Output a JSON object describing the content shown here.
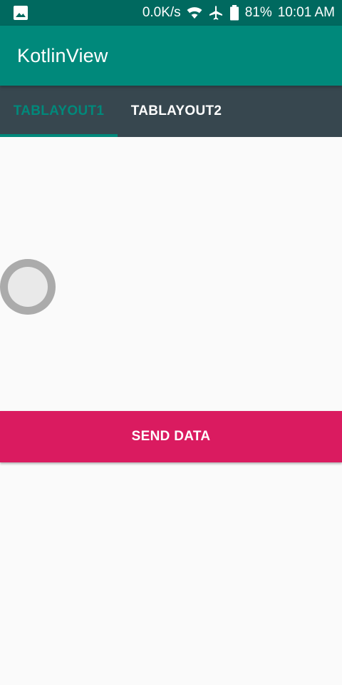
{
  "status_bar": {
    "left_icon": "image-notification-icon",
    "net_speed": "0.0K/s",
    "icons": [
      "wifi-icon",
      "airplane-icon",
      "battery-icon"
    ],
    "battery_percent": "81%",
    "time": "10:01 AM"
  },
  "app_bar": {
    "title": "KotlinView"
  },
  "tabs": [
    {
      "label": "TABLAYOUT1",
      "selected": true
    },
    {
      "label": "TABLAYOUT2",
      "selected": false
    }
  ],
  "main": {
    "send_button_label": "SEND DATA"
  },
  "colors": {
    "status_bar": "#00695f",
    "primary": "#00897b",
    "tab_bar": "#37474f",
    "accent": "#da1b60",
    "background": "#fafafa"
  }
}
